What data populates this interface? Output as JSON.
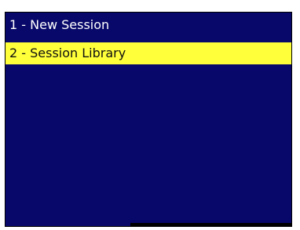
{
  "menu": {
    "items": [
      {
        "label": "1 - New Session",
        "selected": false
      },
      {
        "label": "2 - Session Library",
        "selected": true
      }
    ]
  },
  "colors": {
    "panel_background": "#08086a",
    "selected_background": "#ffff3a",
    "text_normal": "#ffffff",
    "text_selected": "#101010"
  }
}
